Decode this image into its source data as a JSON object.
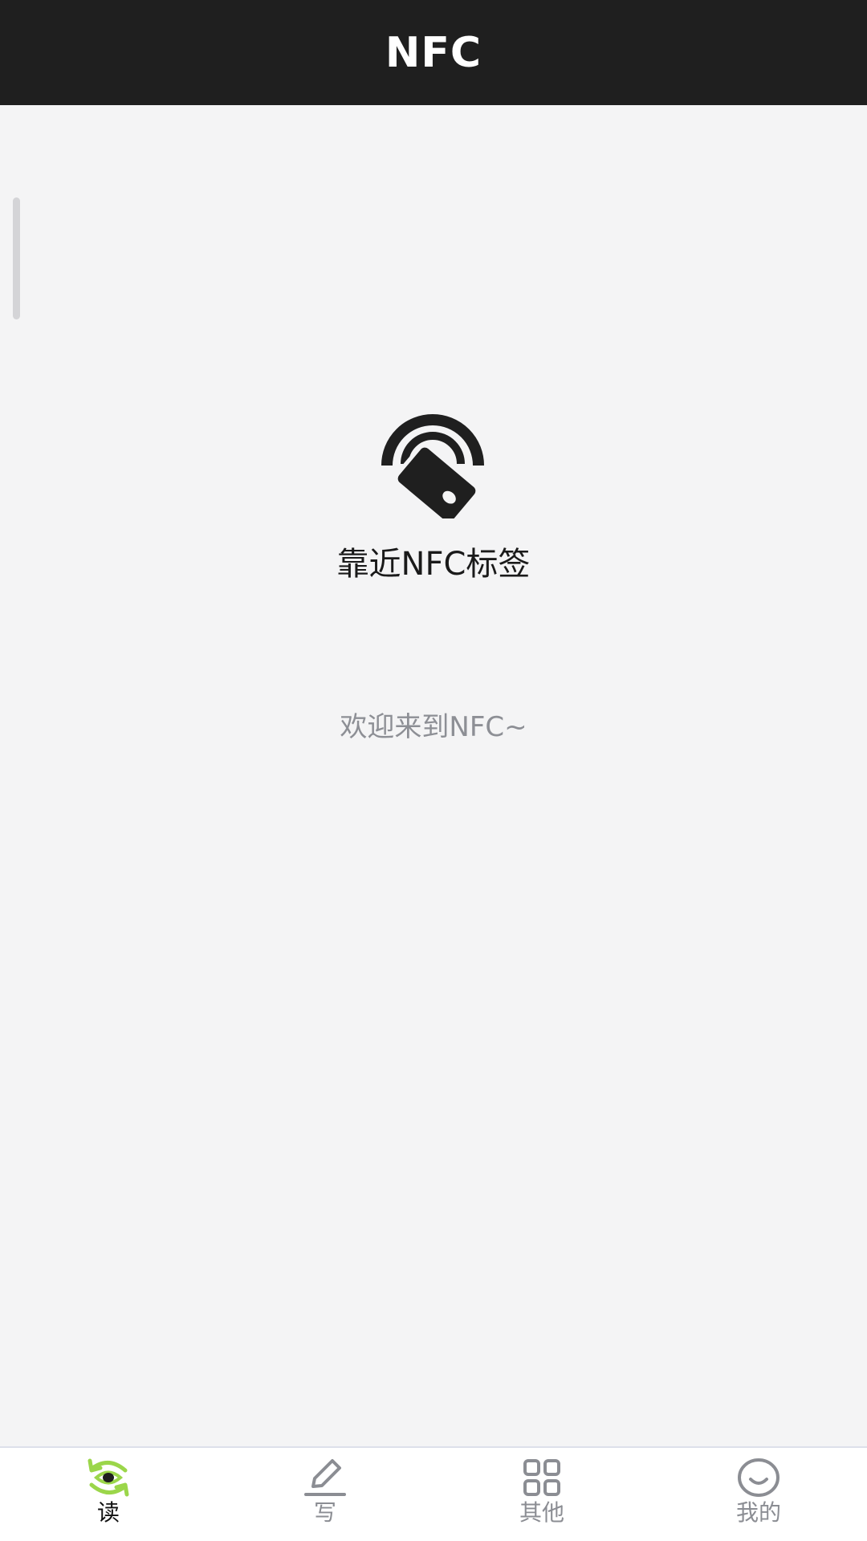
{
  "header": {
    "title": "NFC"
  },
  "main": {
    "prompt": "靠近NFC标签",
    "welcome": "欢迎来到NFC~",
    "icon": "nfc-tap-icon"
  },
  "tabbar": {
    "active_color": "#9bd64a",
    "inactive_color": "#8b8d93",
    "items": [
      {
        "label": "读",
        "icon": "read-refresh-eye-icon",
        "active": true
      },
      {
        "label": "写",
        "icon": "pen-icon",
        "active": false
      },
      {
        "label": "其他",
        "icon": "grid-icon",
        "active": false
      },
      {
        "label": "我的",
        "icon": "smiley-icon",
        "active": false
      }
    ]
  }
}
